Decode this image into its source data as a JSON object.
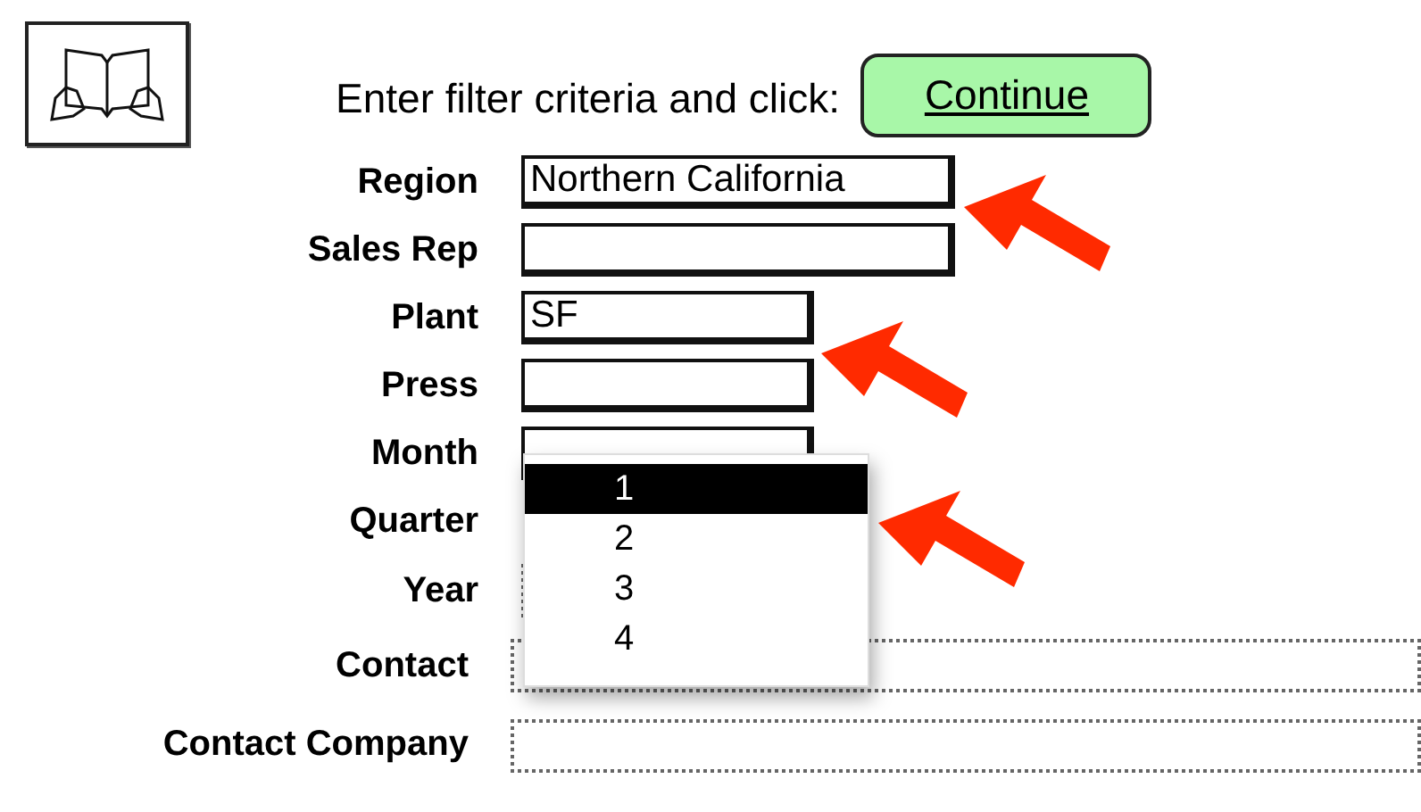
{
  "header": {
    "prompt": "Enter filter criteria and click:",
    "button": "Continue"
  },
  "fields": [
    {
      "label": "Region",
      "kind": "wide",
      "value": "Northern California"
    },
    {
      "label": "Sales Rep",
      "kind": "wide"
    },
    {
      "label": "Plant",
      "kind": "narrow",
      "value": "SF"
    },
    {
      "label": "Press",
      "kind": "narrow"
    },
    {
      "label": "Month",
      "kind": "narrow"
    },
    {
      "label": "Quarter",
      "kind": "dropdown",
      "options": [
        {
          "label": "1",
          "selected": true
        },
        {
          "label": "2",
          "selected": false
        },
        {
          "label": "3",
          "selected": false
        },
        {
          "label": "4",
          "selected": false
        }
      ]
    },
    {
      "label": "Year",
      "kind": "dotted"
    },
    {
      "label": "Contact",
      "kind": "open"
    },
    {
      "label": "Contact Company",
      "kind": "open"
    }
  ]
}
